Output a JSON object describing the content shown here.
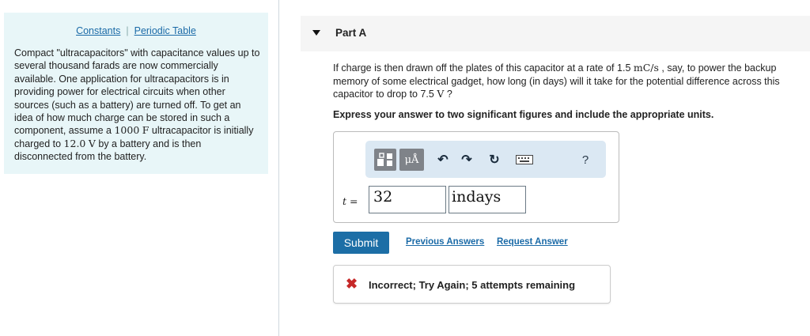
{
  "sidebar": {
    "links": {
      "constants": "Constants",
      "separator": "|",
      "periodic_table": "Periodic Table"
    },
    "intro_before_c": "Compact \"ultracapacitors\" with capacitance values up to several thousand farads are now commercially available. One application for ultracapacitors is in providing power for electrical circuits when other sources (such as a battery) are turned off. To get an idea of how much charge can be stored in such a component, assume a ",
    "capacitance": "1000",
    "capacitance_unit": "F",
    "intro_middle": " ultracapacitor is initially charged to ",
    "initial_voltage": "12.0",
    "voltage_unit": "V",
    "intro_end": " by a battery and is then disconnected from the battery."
  },
  "part": {
    "title": "Part A",
    "question_before_rate": "If charge is then drawn off the plates of this capacitor at a rate of ",
    "rate": "1.5",
    "rate_unit": "mC/s",
    "question_middle": " , say, to power the backup memory of some electrical gadget, how long (in days) will it take for the potential difference across this capacitor to drop to ",
    "final_voltage": "7.5",
    "final_voltage_unit": "V",
    "question_end": " ?",
    "instruction": "Express your answer to two significant figures and include the appropriate units."
  },
  "toolbar": {
    "units_button": "μÅ",
    "undo_icon": "↶",
    "redo_icon": "↷",
    "reset_icon": "↻",
    "help": "?"
  },
  "answer": {
    "variable_label": "t =",
    "value": "32",
    "units": "indays"
  },
  "actions": {
    "submit": "Submit",
    "previous_answers": "Previous Answers",
    "request_answer": "Request Answer"
  },
  "feedback": {
    "icon": "✖",
    "message": "Incorrect; Try Again; 5 attempts remaining",
    "color": "#c62828"
  },
  "colors": {
    "accent": "#1c6ea6",
    "sidebar_bg": "#e8f6f8",
    "toolbar_bg": "#dbe8f3"
  }
}
